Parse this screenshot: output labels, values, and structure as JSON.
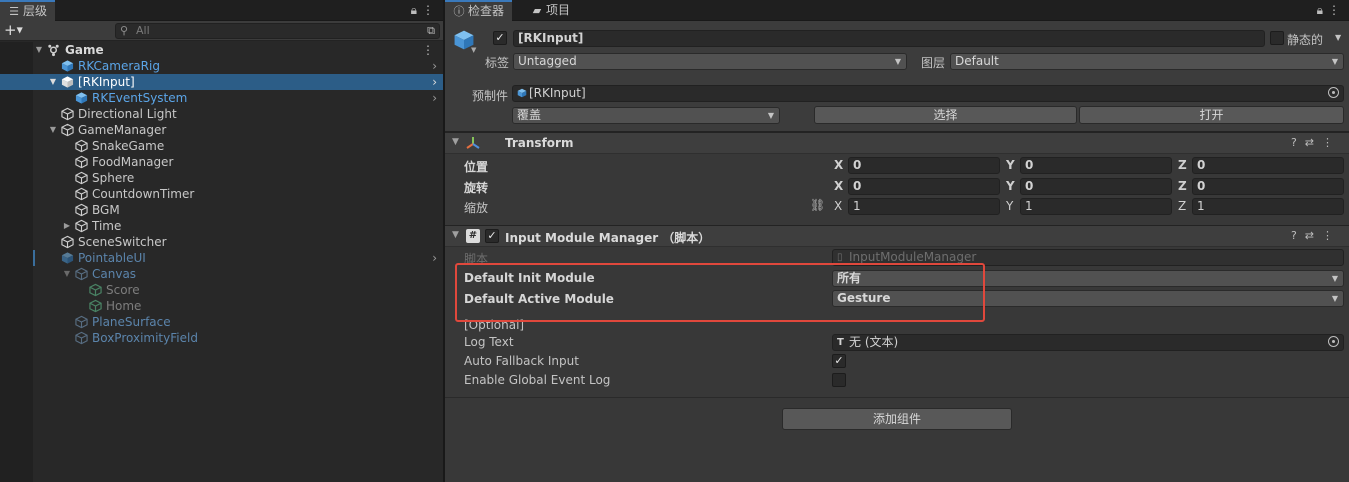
{
  "hierarchy": {
    "tab_label": "层级",
    "search_placeholder": "All",
    "root": "Game",
    "items": [
      {
        "label": "RKCameraRig"
      },
      {
        "label": "[RKInput]"
      },
      {
        "label": "RKEventSystem"
      },
      {
        "label": "Directional Light"
      },
      {
        "label": "GameManager"
      },
      {
        "label": "SnakeGame"
      },
      {
        "label": "FoodManager"
      },
      {
        "label": "Sphere"
      },
      {
        "label": "CountdownTimer"
      },
      {
        "label": "BGM"
      },
      {
        "label": "Time"
      },
      {
        "label": "SceneSwitcher"
      },
      {
        "label": "PointableUI"
      },
      {
        "label": "Canvas"
      },
      {
        "label": "Score"
      },
      {
        "label": "Home"
      },
      {
        "label": "PlaneSurface"
      },
      {
        "label": "BoxProximityField"
      }
    ]
  },
  "inspector": {
    "tab_inspector": "检查器",
    "tab_project": "项目",
    "object_name": "[RKInput]",
    "static_label": "静态的",
    "tag_label": "标签",
    "tag_value": "Untagged",
    "layer_label": "图层",
    "layer_value": "Default",
    "prefab_label": "预制件",
    "prefab_value": "[RKInput]",
    "overrides_value": "覆盖",
    "select_button": "选择",
    "open_button": "打开",
    "transform": {
      "title": "Transform",
      "position_label": "位置",
      "rotation_label": "旋转",
      "scale_label": "缩放",
      "position": {
        "x": "0",
        "y": "0",
        "z": "0"
      },
      "rotation": {
        "x": "0",
        "y": "0",
        "z": "0"
      },
      "scale": {
        "x": "1",
        "y": "1",
        "z": "1"
      },
      "axis_x": "X",
      "axis_y": "Y",
      "axis_z": "Z"
    },
    "script_component": {
      "title": "Input Module Manager （脚本）",
      "script_label": "脚本",
      "script_value": "InputModuleManager",
      "default_init_label": "Default Init Module",
      "default_init_value": "所有",
      "default_active_label": "Default Active Module",
      "default_active_value": "Gesture",
      "optional_header": "[Optional]",
      "log_text_label": "Log Text",
      "log_text_value": "无 (文本)",
      "auto_fallback_label": "Auto Fallback Input",
      "auto_fallback_checked": "✓",
      "enable_global_label": "Enable Global Event Log"
    },
    "add_component_button": "添加组件"
  },
  "colors": {
    "selection": "#2c5d87",
    "highlight_box": "#e0483c",
    "prefab_blue": "#5ba5e8"
  }
}
